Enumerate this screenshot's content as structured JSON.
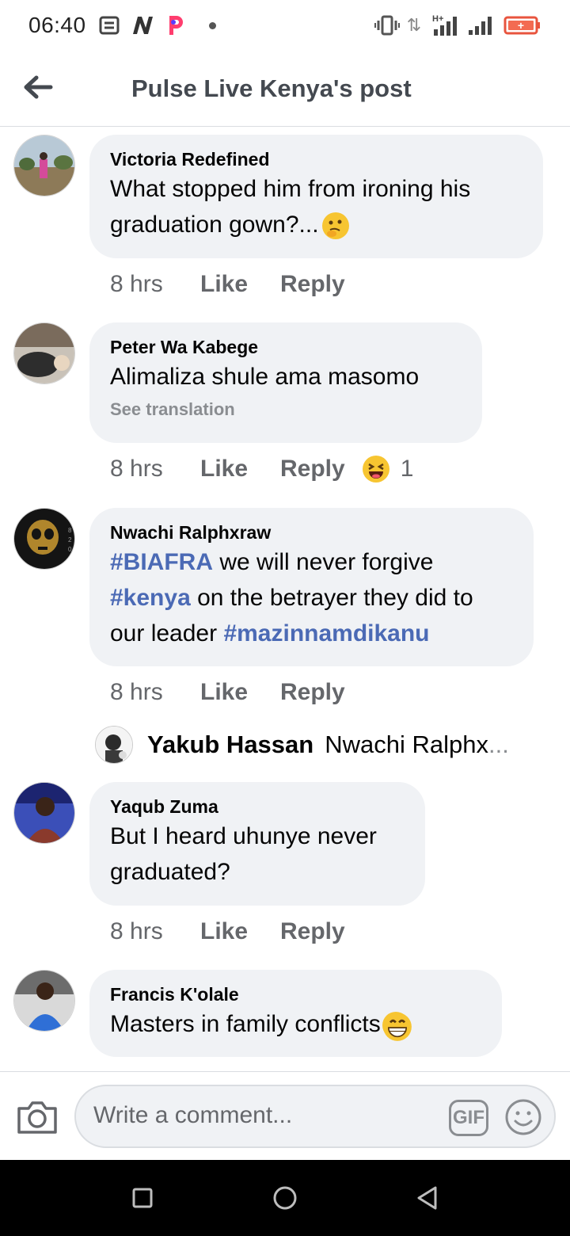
{
  "status_bar": {
    "time": "06:40",
    "data_label": "⇅",
    "network_label": "H+"
  },
  "header": {
    "title": "Pulse Live Kenya's post"
  },
  "comments": [
    {
      "author": "Victoria Redefined",
      "text": "What stopped him from ironing his graduation gown?...",
      "time": "8 hrs",
      "like": "Like",
      "reply": "Reply",
      "emoji": "thinking-face"
    },
    {
      "author": "Peter Wa Kabege",
      "text": "Alimaliza shule ama masomo",
      "see_translation": "See translation",
      "time": "8 hrs",
      "like": "Like",
      "reply": "Reply",
      "reaction_emoji": "haha-reaction",
      "reaction_count": "1"
    },
    {
      "author": "Nwachi Ralphxraw",
      "text_parts": {
        "tag1": "#BIAFRA",
        "t1": " we will never forgive ",
        "tag2": "#kenya",
        "t2": " on the betrayer they did to our leader ",
        "tag3": "#mazinnamdikanu"
      },
      "time": "8 hrs",
      "like": "Like",
      "reply": "Reply",
      "reply_preview": {
        "author": "Yakub Hassan",
        "snippet": "Nwachi Ralphx",
        "ellipsis": "..."
      }
    },
    {
      "author": "Yaqub Zuma",
      "text": "But I heard uhunye never graduated?",
      "time": "8 hrs",
      "like": "Like",
      "reply": "Reply"
    },
    {
      "author": "Francis K'olale",
      "text": "Masters in family conflicts",
      "emoji": "grinning-face"
    }
  ],
  "composer": {
    "placeholder": "Write a comment...",
    "gif_label": "GIF"
  },
  "colors": {
    "bubble": "#f0f2f5",
    "hashtag": "#4b6ab5",
    "meta_text": "#65676b"
  }
}
